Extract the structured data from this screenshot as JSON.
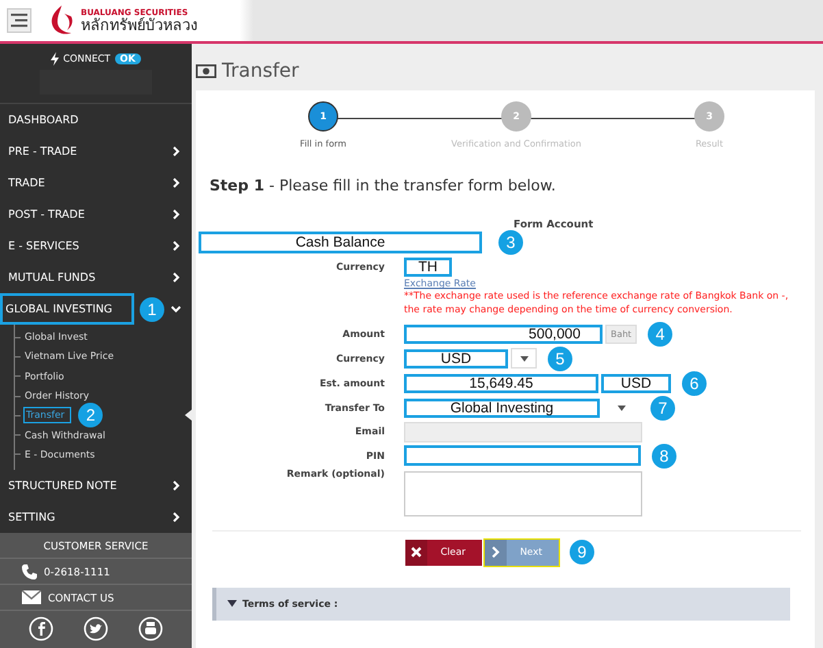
{
  "header": {
    "logo_en": "BUALUANG SECURITIES",
    "logo_th": "หลักทรัพย์บัวหลวง"
  },
  "sidebar": {
    "connect": {
      "label": "CONNECT",
      "status": "OK"
    },
    "menu": [
      {
        "kind": "link",
        "label": "DASHBOARD"
      },
      {
        "kind": "group",
        "label": "PRE - TRADE",
        "expanded": false
      },
      {
        "kind": "group",
        "label": "TRADE",
        "expanded": false
      },
      {
        "kind": "group",
        "label": "POST - TRADE",
        "expanded": false
      },
      {
        "kind": "group",
        "label": "E - SERVICES",
        "expanded": false
      },
      {
        "kind": "group",
        "label": "MUTUAL FUNDS",
        "expanded": false
      },
      {
        "kind": "group",
        "label": "GLOBAL INVESTING",
        "expanded": true,
        "callout": "1",
        "children": [
          {
            "label": "Global Invest",
            "selected": false
          },
          {
            "label": "Vietnam Live Price",
            "selected": false
          },
          {
            "label": "Portfolio",
            "selected": false
          },
          {
            "label": "Order History",
            "selected": false
          },
          {
            "label": "Transfer",
            "selected": true,
            "callout": "2"
          },
          {
            "label": "Cash Withdrawal",
            "selected": false
          },
          {
            "label": "E - Documents",
            "selected": false
          }
        ]
      },
      {
        "kind": "group",
        "label": "STRUCTURED NOTE",
        "expanded": false
      },
      {
        "kind": "group",
        "label": "SETTING",
        "expanded": false
      }
    ],
    "customer_service": {
      "title": "CUSTOMER SERVICE",
      "phone": "0-2618-1111",
      "contact": "CONTACT US"
    }
  },
  "title": "Transfer",
  "steps": [
    {
      "number": "1",
      "label": "Fill in form",
      "selected": true
    },
    {
      "number": "2",
      "label": "Verification and Confirmation",
      "selected": false
    },
    {
      "number": "3",
      "label": "Result",
      "selected": false
    }
  ],
  "instruction": "**Step 1** - Please fill in the transfer form below.",
  "form": {
    "account_label": "Form Account",
    "account_value": "Cash Balance",
    "account_callout": "3",
    "rows": [
      {
        "kind": "text",
        "label": "Currency",
        "value": "TH"
      },
      {
        "kind": "note",
        "link": "Exchange Rate",
        "note": "**The exchange rate used is the reference exchange rate of Bangkok Bank on -, the rate may change depending on the time of currency conversion."
      },
      {
        "kind": "amount",
        "label": "Amount",
        "value": "500,000",
        "addon": "Baht",
        "callout": "4"
      },
      {
        "kind": "select",
        "label": "Currency",
        "value": "USD",
        "callout": "5"
      },
      {
        "kind": "estimate",
        "label": "Est. amount",
        "value": "15,649.45",
        "unit": "USD",
        "callout": "6"
      },
      {
        "kind": "wideselect",
        "label": "Transfer To",
        "value": "Global Investing",
        "callout": "7"
      },
      {
        "kind": "disabled",
        "label": "Email"
      },
      {
        "kind": "input",
        "label": "PIN",
        "callout": "8"
      },
      {
        "kind": "textarea",
        "label": "Remark (optional)"
      }
    ]
  },
  "buttons": [
    {
      "kind": "clear",
      "label": "Clear"
    },
    {
      "kind": "next",
      "label": "Next",
      "callout": "9"
    }
  ],
  "terms": "Terms of service :"
}
